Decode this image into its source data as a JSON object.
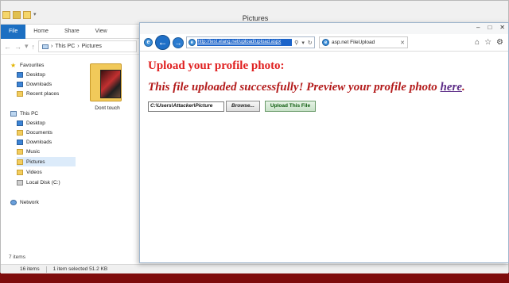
{
  "explorer": {
    "title": "Pictures",
    "ribbon_tabs": [
      "File",
      "Home",
      "Share",
      "View"
    ],
    "address": [
      "This PC",
      "Pictures"
    ],
    "nav": {
      "favourites": "Favourites",
      "desktop": "Desktop",
      "downloads": "Downloads",
      "recent": "Recent places",
      "this_pc": "This PC",
      "pc_desktop": "Desktop",
      "documents": "Documents",
      "pc_downloads": "Downloads",
      "music": "Music",
      "pictures": "Pictures",
      "videos": "Videos",
      "local_disk": "Local Disk (C:)",
      "network": "Network"
    },
    "folder": {
      "label": "Dont touch"
    },
    "items_count": "7 items",
    "status": {
      "items": "16 items",
      "selected": "1 item selected  51.2 KB"
    }
  },
  "browser": {
    "url": "http://test.elang.net/upload/upload.aspx",
    "tab_title": "asp.net FileUpload",
    "content": {
      "heading": "Upload your profile photo:",
      "success_text": "This file uploaded successfully! Preview your profile photo ",
      "link": "here",
      "period": ".",
      "file_value": "C:\\Users\\Attacker\\Picture",
      "browse_label": "Browse...",
      "upload_label": "Upload This File"
    }
  }
}
